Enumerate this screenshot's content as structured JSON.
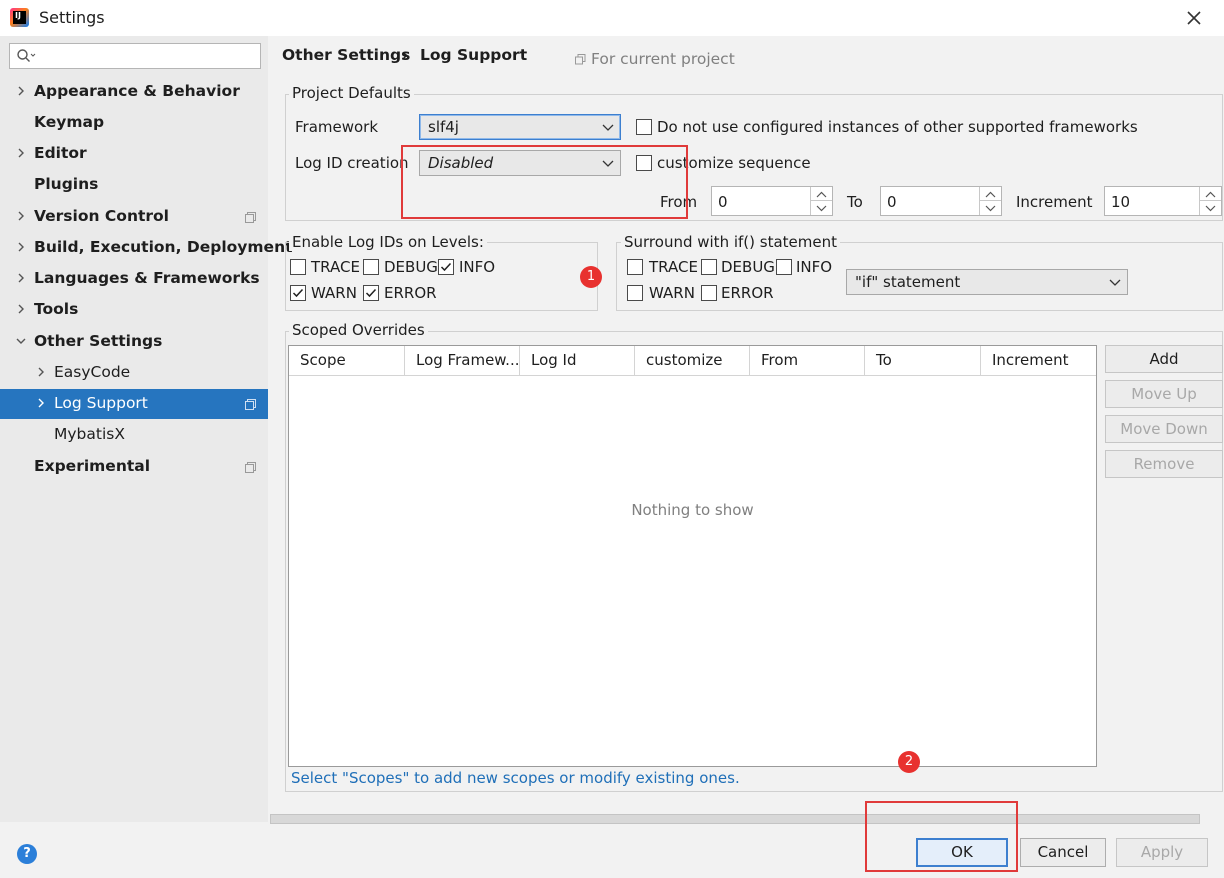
{
  "window": {
    "title": "Settings"
  },
  "sidebar": {
    "search_placeholder": "",
    "items": [
      {
        "label": "Appearance & Behavior"
      },
      {
        "label": "Keymap"
      },
      {
        "label": "Editor"
      },
      {
        "label": "Plugins"
      },
      {
        "label": "Version Control"
      },
      {
        "label": "Build, Execution, Deployment"
      },
      {
        "label": "Languages & Frameworks"
      },
      {
        "label": "Tools"
      },
      {
        "label": "Other Settings"
      },
      {
        "label": "EasyCode"
      },
      {
        "label": "Log Support"
      },
      {
        "label": "MybatisX"
      },
      {
        "label": "Experimental"
      }
    ]
  },
  "header": {
    "breadcrumb_parent": "Other Settings",
    "breadcrumb_sep": "›",
    "breadcrumb_current": "Log Support",
    "scope_label": "For current project"
  },
  "project_defaults": {
    "title": "Project Defaults",
    "framework_label": "Framework",
    "framework_value": "slf4j",
    "no_configured_label": "Do not use configured instances of other supported frameworks",
    "log_id_label": "Log ID creation",
    "log_id_value": "Disabled",
    "customize_label": "customize sequence",
    "from_label": "From",
    "from_value": "0",
    "to_label": "To",
    "to_value": "0",
    "increment_label": "Increment",
    "increment_value": "10"
  },
  "levels": {
    "title": "Enable Log IDs on Levels:",
    "trace": "TRACE",
    "debug": "DEBUG",
    "info": "INFO",
    "warn": "WARN",
    "error": "ERROR"
  },
  "surround": {
    "title": "Surround with if() statement",
    "trace": "TRACE",
    "debug": "DEBUG",
    "info": "INFO",
    "warn": "WARN",
    "error": "ERROR",
    "statement_value": "\"if\" statement"
  },
  "overrides": {
    "title": "Scoped Overrides",
    "columns": [
      "Scope",
      "Log Framew...",
      "Log Id",
      "customize",
      "From",
      "To",
      "Increment"
    ],
    "empty_text": "Nothing to show",
    "hint": "Select \"Scopes\" to add new scopes or modify existing ones.",
    "add_label": "Add",
    "move_up_label": "Move Up",
    "move_down_label": "Move Down",
    "remove_label": "Remove"
  },
  "footer": {
    "help_label": "?",
    "ok_label": "OK",
    "cancel_label": "Cancel",
    "apply_label": "Apply"
  },
  "annotations": {
    "badge1": "1",
    "badge2": "2",
    "color": "#e03a3a"
  },
  "colors": {
    "accent": "#2675bf",
    "link": "#1f6fb8"
  }
}
